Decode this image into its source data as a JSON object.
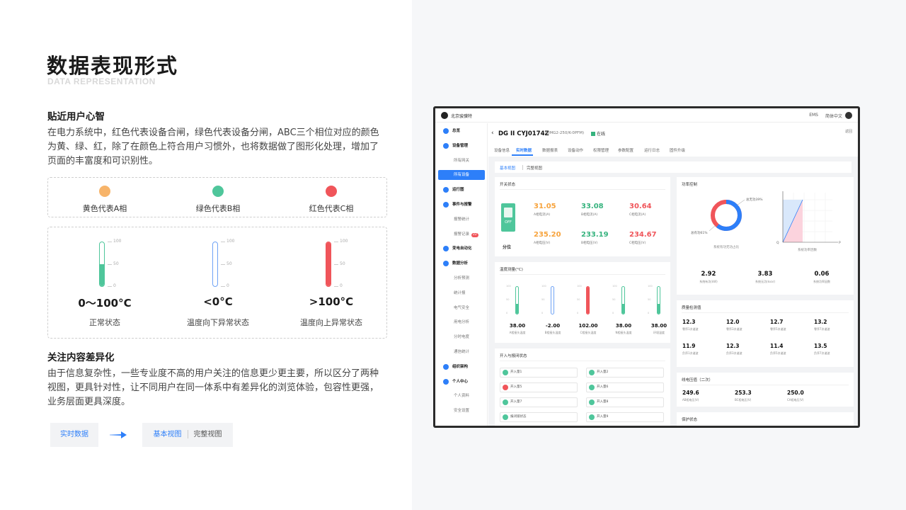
{
  "page": {
    "title": "数据表现形式",
    "subtitle": "DATA REPRESENTATION"
  },
  "section1": {
    "heading": "贴近用户心智",
    "lines": [
      "在电力系统中，红色代表设备合闸，绿色代表设备分闸，ABC三个相位对应的颜色",
      "为黄、绿、红，除了在颜色上符合用户习惯外，也将数据做了图形化处理，增加了",
      "页面的丰富度和可识别性。"
    ]
  },
  "phases": [
    {
      "label": "黄色代表A相",
      "color": "#f7b46a"
    },
    {
      "label": "绿色代表B相",
      "color": "#4fc69b"
    },
    {
      "label": "红色代表C相",
      "color": "#f0555a"
    }
  ],
  "thermometers": {
    "ticks": [
      "100",
      "50",
      "0"
    ],
    "items": [
      {
        "value": "0～100°C",
        "label": "正常状态",
        "color": "#4fc69b",
        "fill": 0.5
      },
      {
        "value": "<0°C",
        "label": "温度向下异常状态",
        "color": "#6fa3f5",
        "fill": 0
      },
      {
        "value": ">100°C",
        "label": "温度向上异常状态",
        "color": "#f0555a",
        "fill": 1.0
      }
    ]
  },
  "section2": {
    "heading": "关注内容差异化",
    "lines": [
      "由于信息复杂性，一些专业度不高的用户关注的信息更少更主要，所以区分了两种",
      "视图，更具针对性，让不同用户在同一体系中有差异化的浏览体验，包容性更强，",
      "业务层面更具深度。"
    ]
  },
  "flow": {
    "realtime": "实时数据",
    "basic": "基本视图",
    "full": "完整视图"
  },
  "app": {
    "brand": "北京骏骥特",
    "ems": "EMS",
    "lang": "简体中文",
    "sidebar": [
      {
        "label": "总览",
        "type": "group"
      },
      {
        "label": "设备管理",
        "type": "group"
      },
      {
        "label": "所有网关",
        "type": "item"
      },
      {
        "label": "所有设备",
        "type": "active"
      },
      {
        "label": "运行图",
        "type": "group"
      },
      {
        "label": "事件与报警",
        "type": "group"
      },
      {
        "label": "报警统计",
        "type": "item"
      },
      {
        "label": "报警记录",
        "type": "item",
        "badge": "22"
      },
      {
        "label": "变电自动化",
        "type": "group"
      },
      {
        "label": "数据分析",
        "type": "group"
      },
      {
        "label": "分析预测",
        "type": "item"
      },
      {
        "label": "统计报",
        "type": "item"
      },
      {
        "label": "电气安全",
        "type": "item"
      },
      {
        "label": "用电分析",
        "type": "item"
      },
      {
        "label": "分时电度",
        "type": "item"
      },
      {
        "label": "通信统计",
        "type": "item"
      },
      {
        "label": "组织架构",
        "type": "group"
      },
      {
        "label": "个人中心",
        "type": "group"
      },
      {
        "label": "个人资料",
        "type": "item"
      },
      {
        "label": "安全设置",
        "type": "item"
      }
    ],
    "device": {
      "name": "DG II CYJ0174Z",
      "model": "(DMG2-250/K-0PFM)",
      "status": "在线",
      "back": "返回"
    },
    "tabs": [
      "设备信息",
      "实时数据",
      "数据报表",
      "设备动作",
      "权限管理",
      "参数配置",
      "运行日志",
      "固件升级"
    ],
    "active_tab": 1,
    "views": {
      "basic": "基本视图",
      "full": "完整视图"
    },
    "switch_card": {
      "title": "开关状态",
      "off": "OFF",
      "state": "分位",
      "readings": [
        {
          "value": "31.05",
          "label": "A相电流(A)",
          "color": "#f7a33c"
        },
        {
          "value": "33.08",
          "label": "B相电流(A)",
          "color": "#36b37e"
        },
        {
          "value": "30.64",
          "label": "C相电流(A)",
          "color": "#f0555a"
        },
        {
          "value": "235.20",
          "label": "A相电压(V)",
          "color": "#f7a33c"
        },
        {
          "value": "233.19",
          "label": "B相电压(V)",
          "color": "#36b37e"
        },
        {
          "value": "234.67",
          "label": "C相电压(V)",
          "color": "#f0555a"
        }
      ]
    },
    "temp_card": {
      "title": "温度测量(°C)",
      "ticks": [
        "100",
        "50",
        "0"
      ],
      "items": [
        {
          "value": "38.00",
          "label": "A相接头温度",
          "color": "#4fc69b",
          "fill": 0.38
        },
        {
          "value": "-2.00",
          "label": "B相接头温度",
          "color": "#6fa3f5",
          "fill": 0
        },
        {
          "value": "102.00",
          "label": "C相接头温度",
          "color": "#f0555a",
          "fill": 1
        },
        {
          "value": "38.00",
          "label": "N相接头温度",
          "color": "#4fc69b",
          "fill": 0.38
        },
        {
          "value": "38.00",
          "label": "环境温度",
          "color": "#4fc69b",
          "fill": 0.38
        }
      ]
    },
    "io_card": {
      "title": "开入与报闭状态",
      "items": [
        {
          "label": "开入量1",
          "red": false
        },
        {
          "label": "开入量2",
          "red": false
        },
        {
          "label": "开入量5",
          "red": true
        },
        {
          "label": "开入量6",
          "red": false
        },
        {
          "label": "开入量7",
          "red": false
        },
        {
          "label": "开入量8",
          "red": false
        },
        {
          "label": "报闭锁状态",
          "red": false
        },
        {
          "label": "开入量9",
          "red": false
        }
      ]
    },
    "power_card": {
      "title": "功率控制",
      "donut_high": "总无功39%",
      "donut_low": "总有功61%",
      "donut_caption": "系统有功无功占比",
      "donut_share": 0.61,
      "chart_caption": "系统功率因数",
      "axis_p": "P",
      "axis_q": "Q",
      "stats": [
        {
          "value": "2.92",
          "label": "系统有功(kW)"
        },
        {
          "value": "3.83",
          "label": "系统无功(kvar)"
        },
        {
          "value": "0.06",
          "label": "系统功率因数"
        }
      ]
    },
    "quality_card": {
      "title": "质量检测值",
      "items": [
        {
          "value": "12.3",
          "label": "零序1次谐波"
        },
        {
          "value": "12.0",
          "label": "零序3次谐波"
        },
        {
          "value": "12.7",
          "label": "零序5次谐波"
        },
        {
          "value": "13.2",
          "label": "零序7次谐波"
        },
        {
          "value": "11.9",
          "label": "负序1次谐波"
        },
        {
          "value": "12.3",
          "label": "负序3次谐波"
        },
        {
          "value": "11.4",
          "label": "负序5次谐波"
        },
        {
          "value": "13.5",
          "label": "负序7次谐波"
        }
      ]
    },
    "line_card": {
      "title": "线电压值（二次）",
      "items": [
        {
          "value": "249.6",
          "label": "AB相电压(V)"
        },
        {
          "value": "253.3",
          "label": "BC相电压(V)"
        },
        {
          "value": "250.0",
          "label": "CA相电压(V)"
        }
      ]
    },
    "protect_card": {
      "title": "保护状态"
    }
  }
}
